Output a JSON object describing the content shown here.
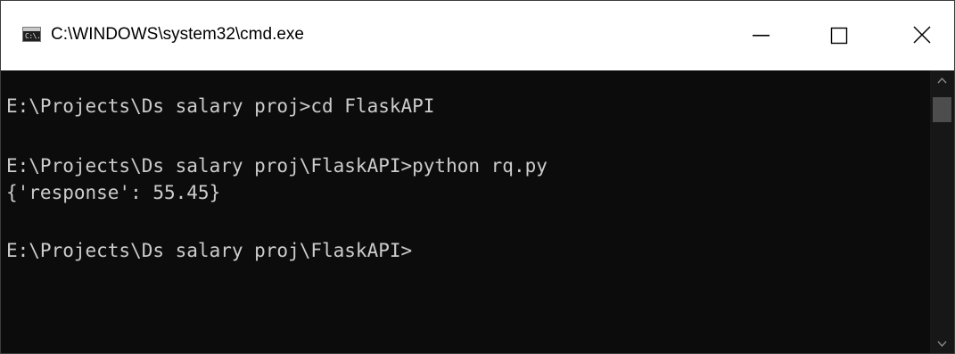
{
  "window": {
    "title": "C:\\WINDOWS\\system32\\cmd.exe",
    "app_icon_text": "C:\\."
  },
  "console": {
    "lines": [
      "E:\\Projects\\Ds salary proj>cd FlaskAPI",
      "",
      "E:\\Projects\\Ds salary proj\\FlaskAPI>python rq.py",
      "{'response': 55.45}",
      "",
      "E:\\Projects\\Ds salary proj\\FlaskAPI>"
    ]
  },
  "colors": {
    "console_background": "#0c0c0c",
    "console_text": "#cccccc",
    "titlebar_background": "#ffffff"
  }
}
